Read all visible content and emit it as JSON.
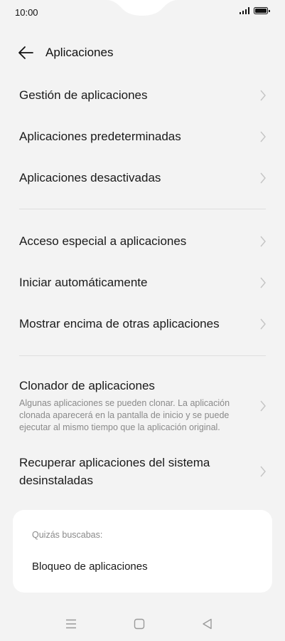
{
  "status_bar": {
    "time": "10:00"
  },
  "header": {
    "title": "Aplicaciones",
    "back_icon": "arrow-left-icon"
  },
  "section1": [
    {
      "label": "Gestión de aplicaciones"
    },
    {
      "label": "Aplicaciones predeterminadas"
    },
    {
      "label": "Aplicaciones desactivadas"
    }
  ],
  "section2": [
    {
      "label": "Acceso especial a aplicaciones"
    },
    {
      "label": "Iniciar automáticamente"
    },
    {
      "label": "Mostrar encima de otras aplicaciones"
    }
  ],
  "section3": {
    "clonador": {
      "label": "Clonador de aplicaciones",
      "description": "Algunas aplicaciones se pueden clonar. La aplicación clonada aparecerá en la pantalla de inicio y se puede ejecutar al mismo tiempo que la aplicación original."
    },
    "recuperar": {
      "label_line1": "Recuperar aplicaciones del sistema",
      "label_line2": "desinstaladas"
    }
  },
  "suggestions": {
    "caption": "Quizás buscabas:",
    "item": "Bloqueo de aplicaciones"
  },
  "nav_bar": {
    "menu_icon": "menu-icon",
    "home_icon": "home-square-icon",
    "back_icon": "back-triangle-icon"
  },
  "colors": {
    "background": "#f3f3f3",
    "card": "#ffffff",
    "text": "#1a1a1a",
    "secondary_text": "#8a8a8a",
    "chevron": "#c4c4c4"
  }
}
